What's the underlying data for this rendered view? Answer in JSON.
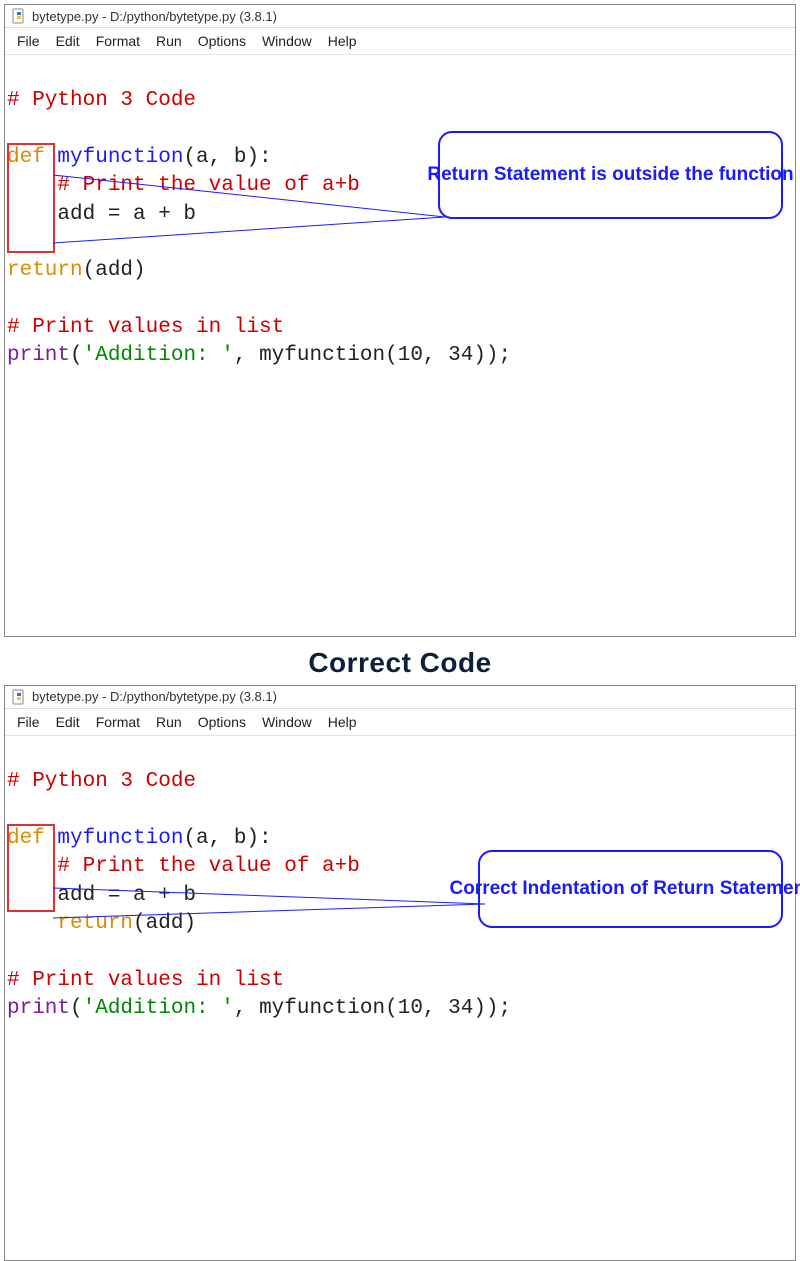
{
  "title": "bytetype.py - D:/python/bytetype.py (3.8.1)",
  "menu": {
    "items": [
      "File",
      "Edit",
      "Format",
      "Run",
      "Options",
      "Window",
      "Help"
    ]
  },
  "sectionTitle": "Correct Code",
  "callouts": {
    "top": "Return Statement is outside the function",
    "bottom": "Correct Indentation of Return Statement"
  },
  "code1": {
    "c0": "# Python 3 Code",
    "l2_kw": "def",
    "l2_fn": " myfunction",
    "l2_rest": "(a, b):",
    "l3": "    # Print the value of a+b",
    "l4": "    add = a + b",
    "l6_kw": "return",
    "l6_rest": "(add)",
    "l8": "# Print values in list",
    "l9_print": "print",
    "l9_open": "(",
    "l9_str": "'Addition: '",
    "l9_comma": ", ",
    "l9_fn": "myfunction",
    "l9_args": "(10, 34));"
  },
  "code2": {
    "c0": "# Python 3 Code",
    "l2_kw": "def",
    "l2_fn": " myfunction",
    "l2_rest": "(a, b):",
    "l3": "    # Print the value of a+b",
    "l4": "    add = a + b",
    "l5_ind": "    ",
    "l5_kw": "return",
    "l5_rest": "(add)",
    "l7": "# Print values in list",
    "l8_print": "print",
    "l8_open": "(",
    "l8_str": "'Addition: '",
    "l8_comma": ", ",
    "l8_fn": "myfunction",
    "l8_args": "(10, 34));"
  }
}
